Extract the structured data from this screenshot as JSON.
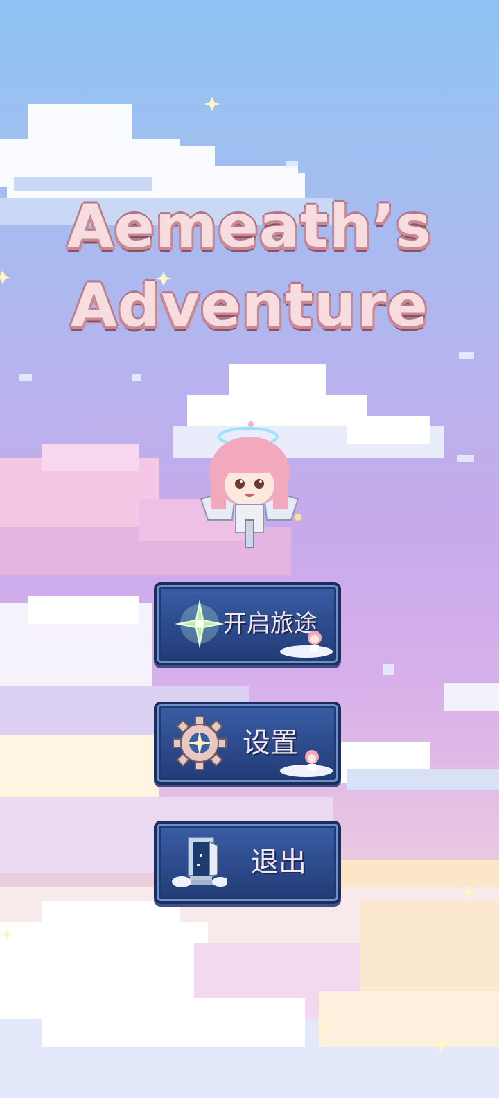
{
  "game": {
    "title_line1": "Aemeath’s",
    "title_line2": "Adventure"
  },
  "menu": {
    "start": {
      "label": "开启旅途",
      "icon": "sparkle-star-icon"
    },
    "settings": {
      "label": "设置",
      "icon": "gear-icon"
    },
    "exit": {
      "label": "退出",
      "icon": "door-icon"
    }
  },
  "colors": {
    "sky_top": "#8ec3f3",
    "sky_bottom": "#f7e9cf",
    "button_fill": "#2c4a8c",
    "button_border": "#1b2d5c",
    "title_fill": "#f7dde0",
    "title_outline": "#8d4f63"
  }
}
